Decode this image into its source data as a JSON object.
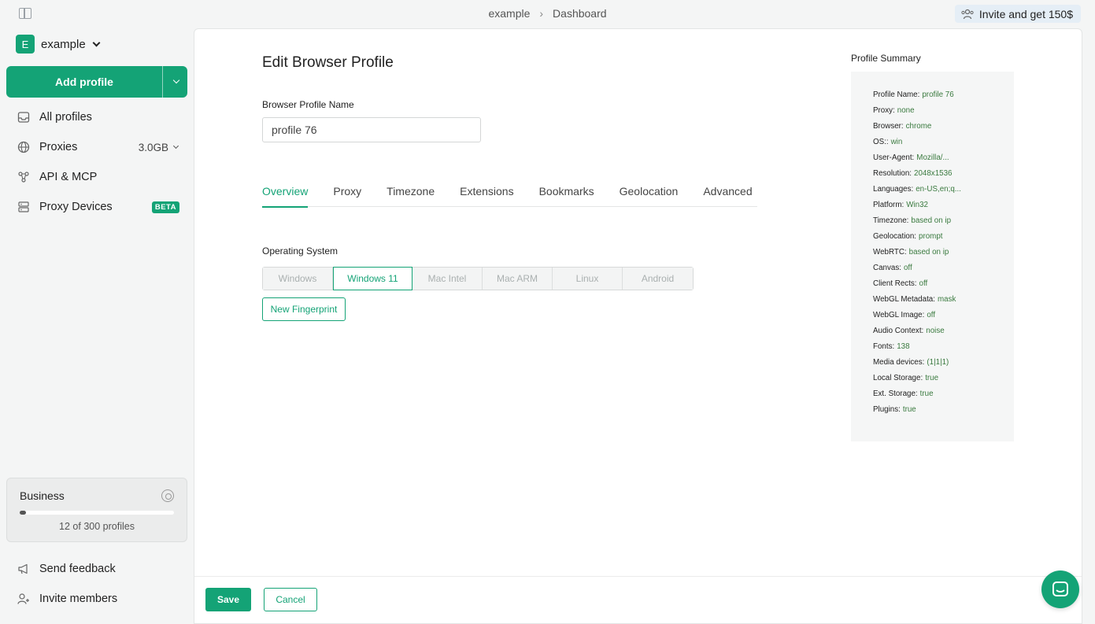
{
  "header": {
    "breadcrumb": [
      "example",
      "Dashboard"
    ],
    "invite_label": "Invite and get 150$"
  },
  "sidebar": {
    "workspace_initial": "E",
    "workspace_name": "example",
    "add_profile_label": "Add profile",
    "items": [
      {
        "label": "All profiles",
        "icon": "inbox-icon"
      },
      {
        "label": "Proxies",
        "icon": "globe-icon",
        "extra": "3.0GB"
      },
      {
        "label": "API & MCP",
        "icon": "api-icon"
      },
      {
        "label": "Proxy Devices",
        "icon": "server-icon",
        "badge": "BETA"
      }
    ],
    "plan": {
      "name": "Business",
      "used": 12,
      "total": 300,
      "usage_text": "12 of 300 profiles"
    },
    "bottom_items": [
      {
        "label": "Send feedback",
        "icon": "megaphone-icon"
      },
      {
        "label": "Invite members",
        "icon": "user-plus-icon"
      }
    ]
  },
  "main": {
    "title": "Edit Browser Profile",
    "name_label": "Browser Profile Name",
    "name_value": "profile 76",
    "tabs": [
      "Overview",
      "Proxy",
      "Timezone",
      "Extensions",
      "Bookmarks",
      "Geolocation",
      "Advanced"
    ],
    "active_tab": "Overview",
    "os_label": "Operating System",
    "os_options": [
      "Windows",
      "Windows 11",
      "Mac Intel",
      "Mac ARM",
      "Linux",
      "Android"
    ],
    "os_selected": "Windows 11",
    "new_fingerprint_label": "New Fingerprint",
    "save_label": "Save",
    "cancel_label": "Cancel"
  },
  "summary": {
    "title": "Profile Summary",
    "rows": [
      {
        "k": "Profile Name:",
        "v": "profile 76"
      },
      {
        "k": "Proxy:",
        "v": "none"
      },
      {
        "k": "Browser:",
        "v": "chrome"
      },
      {
        "k": "OS::",
        "v": "win"
      },
      {
        "k": "User-Agent:",
        "v": "Mozilla/..."
      },
      {
        "k": "Resolution:",
        "v": "2048x1536"
      },
      {
        "k": "Languages:",
        "v": "en-US,en;q..."
      },
      {
        "k": "Platform:",
        "v": "Win32"
      },
      {
        "k": "Timezone:",
        "v": "based on ip"
      },
      {
        "k": "Geolocation:",
        "v": "prompt"
      },
      {
        "k": "WebRTC:",
        "v": "based on ip"
      },
      {
        "k": "Canvas:",
        "v": "off"
      },
      {
        "k": "Client Rects:",
        "v": "off"
      },
      {
        "k": "WebGL Metadata:",
        "v": "mask"
      },
      {
        "k": "WebGL Image:",
        "v": "off"
      },
      {
        "k": "Audio Context:",
        "v": "noise"
      },
      {
        "k": "Fonts:",
        "v": "138"
      },
      {
        "k": "Media devices:",
        "v": "(1|1|1)"
      },
      {
        "k": "Local Storage:",
        "v": "true"
      },
      {
        "k": "Ext. Storage:",
        "v": "true"
      },
      {
        "k": "Plugins:",
        "v": "true"
      }
    ]
  },
  "colors": {
    "accent": "#14a376"
  }
}
